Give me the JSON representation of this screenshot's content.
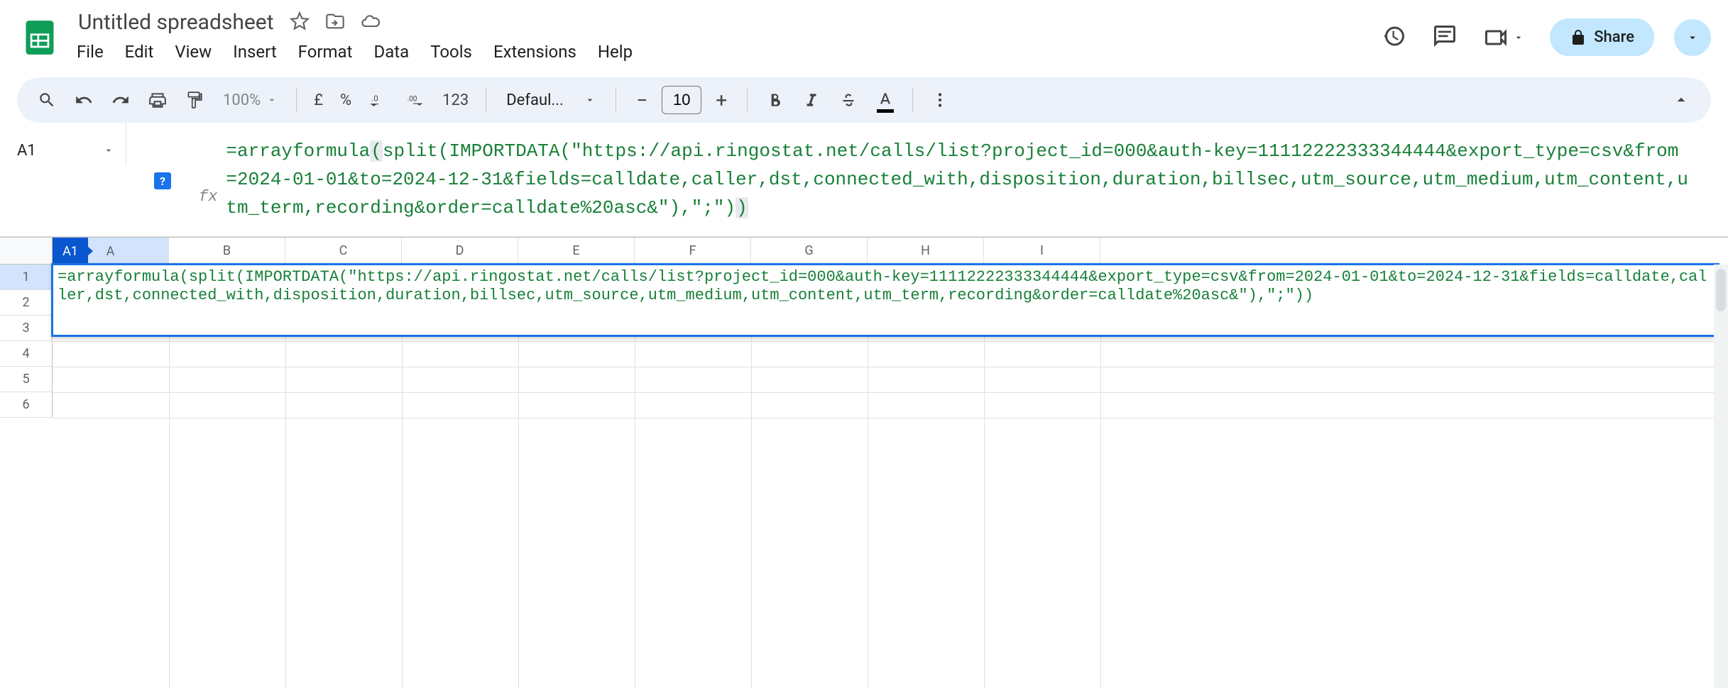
{
  "doc": {
    "title": "Untitled spreadsheet"
  },
  "menu": {
    "file": "File",
    "edit": "Edit",
    "view": "View",
    "insert": "Insert",
    "format": "Format",
    "data": "Data",
    "tools": "Tools",
    "extensions": "Extensions",
    "help": "Help"
  },
  "header": {
    "share": "Share"
  },
  "toolbar": {
    "zoom": "100%",
    "currency": "£",
    "percent": "%",
    "dec_dec": ".0",
    "inc_dec": ".00",
    "num_fmt": "123",
    "font": "Defaul...",
    "font_size": "10"
  },
  "name_box": {
    "ref": "A1"
  },
  "formula_bar": {
    "help": "?",
    "fx": "fx",
    "prefix": "=arrayformula",
    "body": "split(IMPORTDATA(\"https://api.ringostat.net/calls/list?project_id=000&auth-key=11112222333344444&export_type=csv&from=2024-01-01&to=2024-12-31&fields=calldate,caller,dst,connected_with,disposition,duration,billsec,utm_source,utm_medium,utm_content,utm_term,recording&order=calldate%20asc&\"),\";\")",
    "suffix": ")"
  },
  "grid": {
    "a1_indicator": "A1",
    "columns": [
      "A",
      "B",
      "C",
      "D",
      "E",
      "F",
      "G",
      "H",
      "I"
    ],
    "rows": [
      "1",
      "2",
      "3",
      "4",
      "5",
      "6"
    ],
    "cell_edit_text": "=arrayformula(split(IMPORTDATA(\"https://api.ringostat.net/calls/list?project_id=000&auth-key=11112222333344444&export_type=csv&from=2024-01-01&to=2024-12-31&fields=calldate,caller,dst,connected_with,disposition,duration,billsec,utm_source,utm_medium,utm_content,utm_term,recording&order=calldate%20asc&\"),\";\"))"
  }
}
